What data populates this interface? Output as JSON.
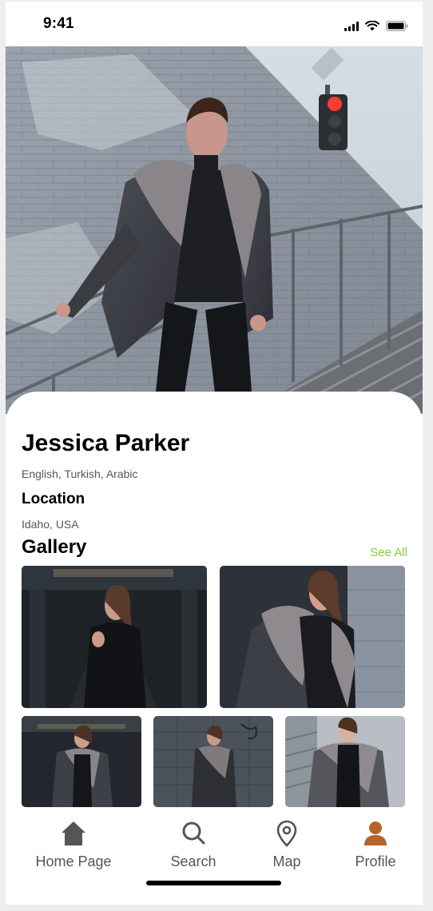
{
  "status_bar": {
    "time": "9:41"
  },
  "profile": {
    "name": "Jessica Parker",
    "languages": "English, Turkish, Arabic",
    "location_label": "Location",
    "location_value": "Idaho, USA"
  },
  "gallery": {
    "title": "Gallery",
    "see_all_label": "See All",
    "photo_count": 5
  },
  "tab_bar": {
    "items": [
      {
        "label": "Home Page",
        "icon": "home-icon",
        "active": false
      },
      {
        "label": "Search",
        "icon": "search-icon",
        "active": false
      },
      {
        "label": "Map",
        "icon": "map-pin-icon",
        "active": false
      },
      {
        "label": "Profile",
        "icon": "user-icon",
        "active": true
      }
    ]
  },
  "colors": {
    "accent_green": "#8cc63f",
    "active_tab": "#b5652a",
    "inactive_tab": "#555555"
  }
}
